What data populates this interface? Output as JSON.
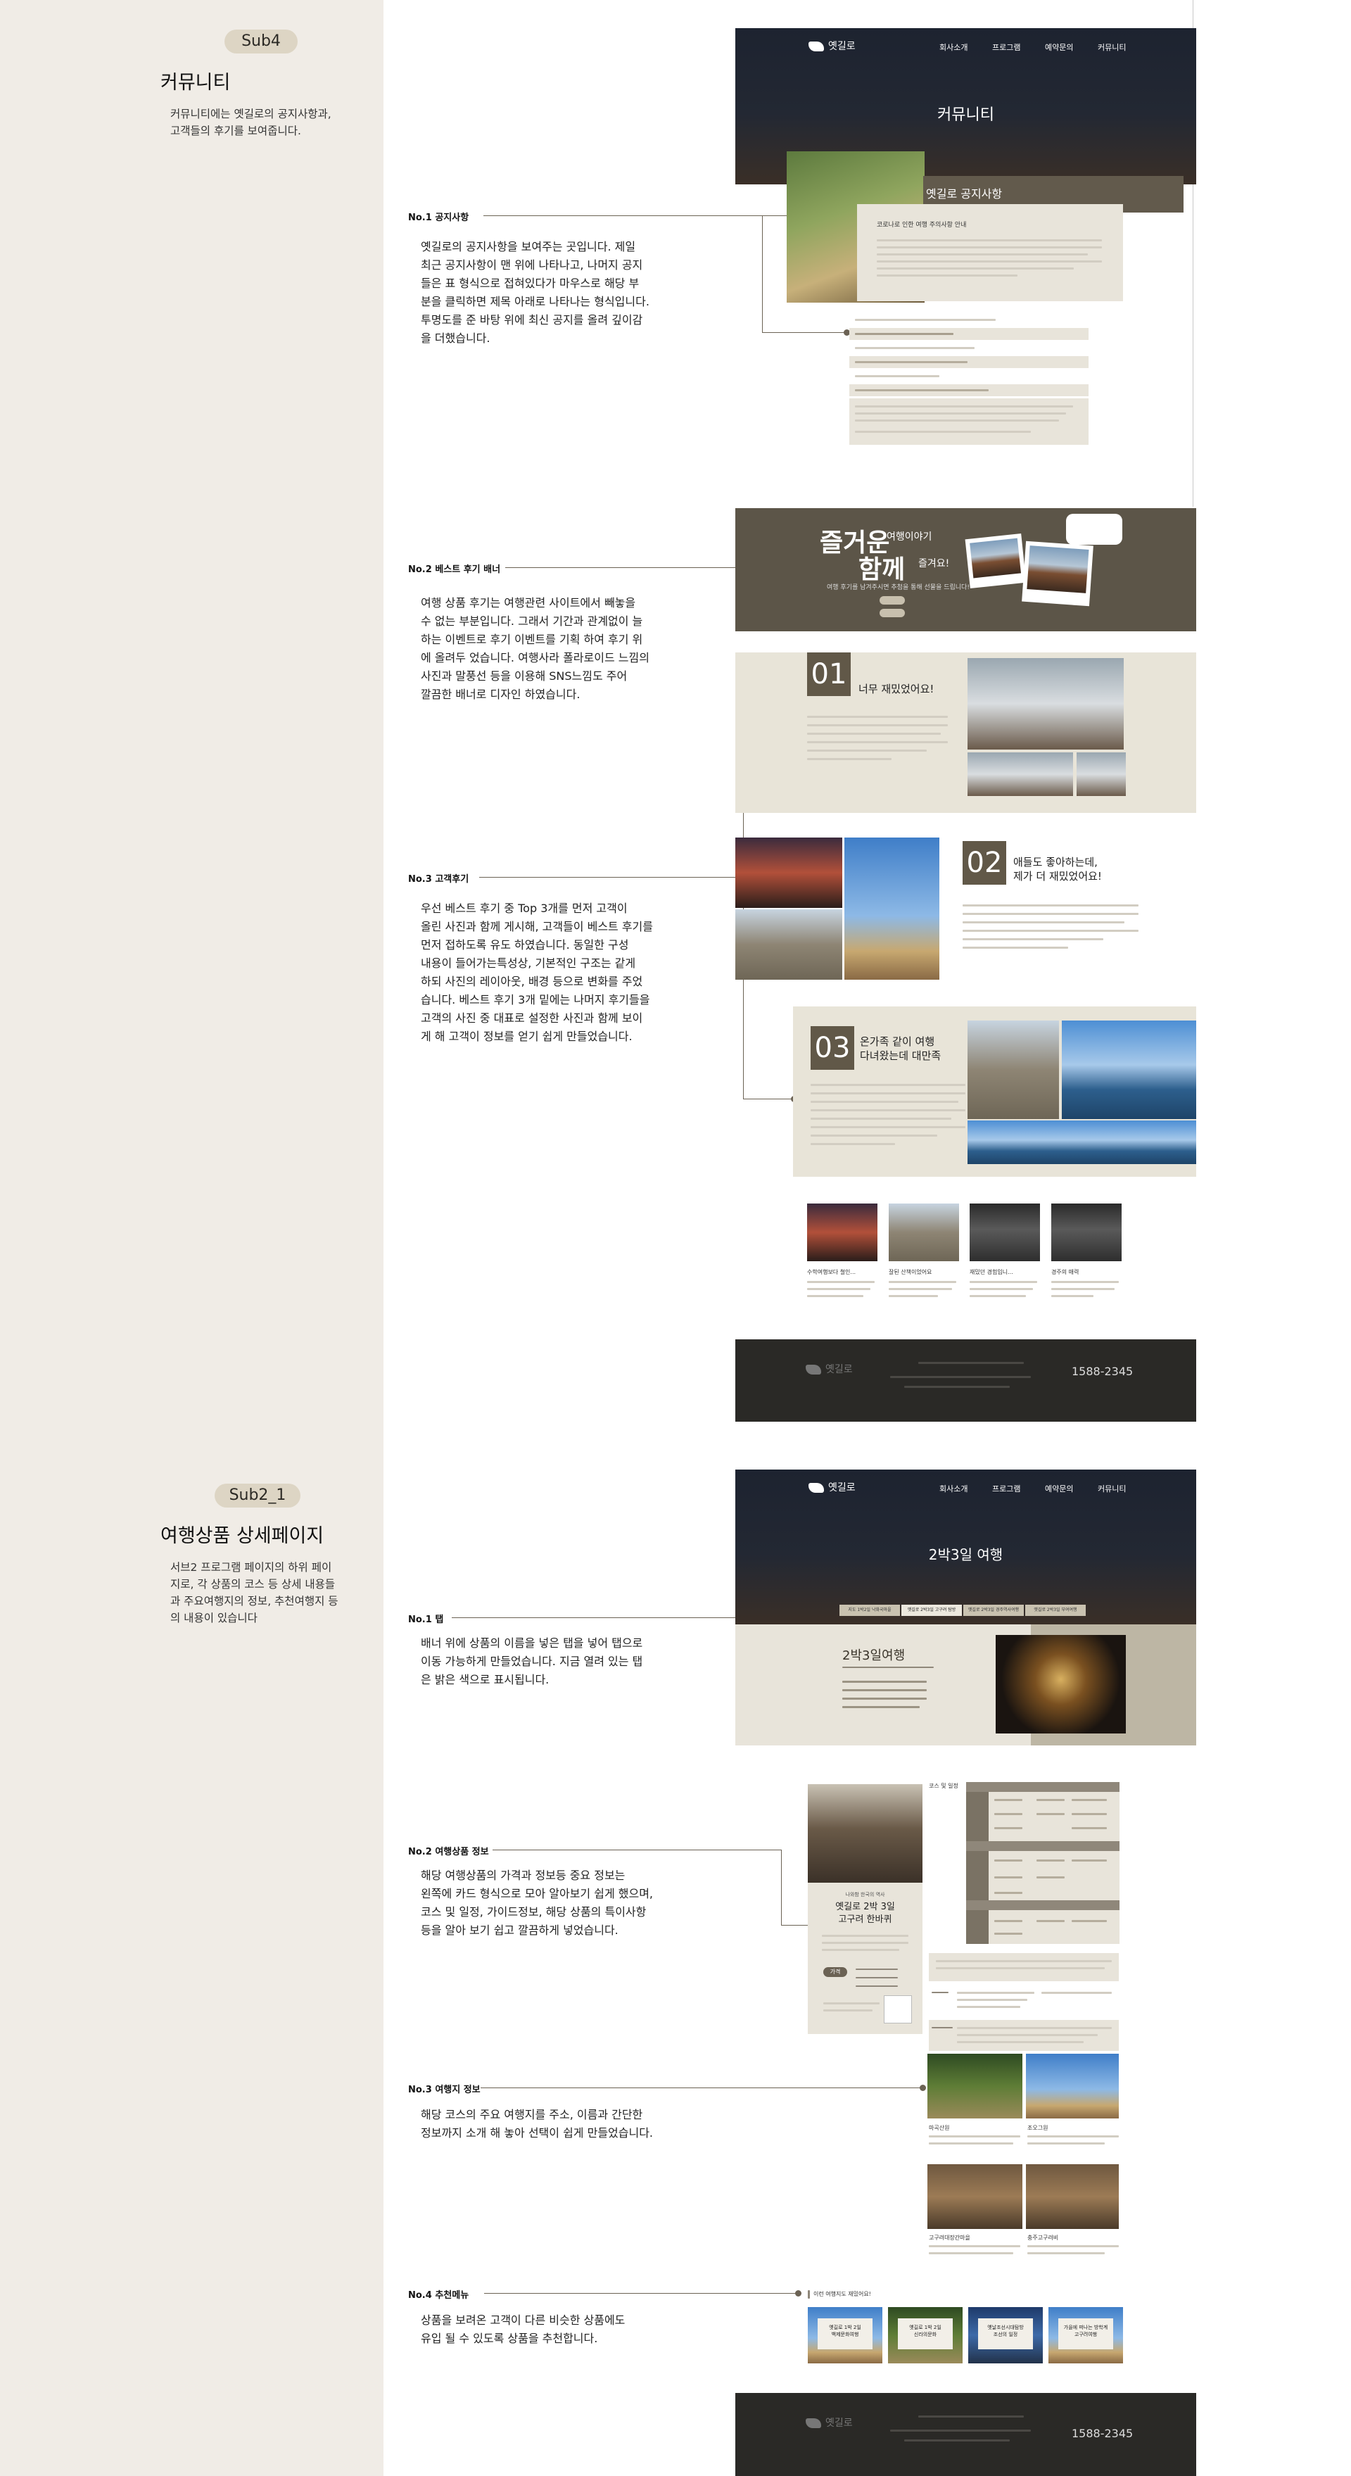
{
  "sections": {
    "sub4": {
      "badge": "Sub4",
      "title": "커뮤니티",
      "desc": "커뮤니티에는 옛길로의 공지사항과,\n고객들의 후기를 보여줍니다."
    },
    "sub2_1": {
      "badge": "Sub2_1",
      "title": "여행상품 상세페이지",
      "desc": "서브2 프로그램 페이지의 하위 페이\n지로, 각 상품의 코스 등 상세 내용들\n과 주요여행지의 정보, 추천여행지 등\n의 내용이 있습니다"
    }
  },
  "notes": {
    "n1": {
      "label": "No.1 공지사항",
      "text": "옛길로의 공지사항을 보여주는 곳입니다. 제일\n최근 공지사항이 맨 위에 나타나고, 나머지 공지\n들은 표 형식으로 접혀있다가 마우스로 해당 부\n분을 클릭하면 제목 아래로 나타나는 형식입니다.\n투명도를 준 바탕 위에 최신 공지를 올려 깊이감\n을 더했습니다."
    },
    "n2": {
      "label": "No.2 베스트 후기 배너",
      "text": "여행 상품 후기는 여행관련 사이트에서 빼놓을\n수 없는 부분입니다. 그래서 기간과 관계없이 늘\n하는 이벤트로 후기 이벤트를 기획 하여 후기 위\n에 올려두 었습니다. 여행사라 폴라로이드 느낌의\n사진과 말풍선 등을 이용해 SNS느낌도 주어\n깔끔한 배너로 디자인 하였습니다."
    },
    "n3": {
      "label": "No.3 고객후기",
      "text": "우선 베스트 후기 중 Top 3개를 먼저 고객이\n올린 사진과 함께 게시해, 고객들이 베스트 후기를\n먼저 접하도록 유도 하였습니다. 동일한 구성\n내용이 들어가는특성상, 기본적인 구조는 같게\n하되 사진의 레이아웃, 배경 등으로 변화를 주었\n습니다. 베스트 후기 3개 밑에는 나머지 후기들을\n고객의 사진 중 대표로 설정한 사진과 함께 보이\n게 해 고객이 정보를 얻기 쉽게 만들었습니다."
    },
    "n4": {
      "label": "No.1 탭",
      "text": "배너 위에 상품의 이름을 넣은 탭을 넣어 탭으로\n이동 가능하게 만들었습니다. 지금 열려 있는 탭\n은 밝은 색으로 표시됩니다."
    },
    "n5": {
      "label": "No.2 여행상품 정보",
      "text": "해당 여행상품의 가격과 정보등 중요 정보는\n왼쪽에 카드 형식으로 모아 알아보기 쉽게 했으며,\n코스 및 일정, 가이드정보, 해당 상품의 특이사항\n등을 알아 보기 쉽고 깔끔하게 넣었습니다."
    },
    "n6": {
      "label": "No.3 여행지 정보",
      "text": "해당 코스의 주요 여행지를 주소, 이름과 간단한\n정보까지 소개 해 놓아 선택이 쉽게 만들었습니다."
    },
    "n7": {
      "label": "No.4 추천메뉴",
      "text": "상품을 보려온 고객이 다른 비슷한 상품에도\n유입 될 수 있도록 상품을 추천합니다."
    }
  },
  "mock_community": {
    "logo": "옛길로",
    "nav": [
      "회사소개",
      "프로그램",
      "예약문의",
      "커뮤니티"
    ],
    "hero_title": "커뮤니티",
    "notice_title": "옛길로 공지사항",
    "notice_headline": "코로나로 인한 여행 주의사항 안내",
    "banner_big1": "즐거운",
    "banner_small1": "여행이야기",
    "banner_big2": "함께",
    "banner_small2": "즐겨요!",
    "banner_sub": "여행 후기를 남겨주시면 추첨을 통해 선물을 드립니다!",
    "review1": "너무 재밌었어요!",
    "review2": "애들도 좋아하는데,\n제가 더 재밌었어요!",
    "review3": "온가족 같이 여행\n다녀왔는데 대만족",
    "nums": [
      "01",
      "02",
      "03"
    ],
    "thumbs": [
      "수학여행보다 철인...",
      "잘된 산책이었어요",
      "재밌던 경험입니...",
      "경주의 매력"
    ],
    "footer_phone": "1588-2345"
  },
  "mock_detail": {
    "logo": "옛길로",
    "nav": [
      "회사소개",
      "프로그램",
      "예약문의",
      "커뮤니티"
    ],
    "hero_title": "2박3일 여행",
    "tabs": [
      "지도 1박2일 낙화국마을",
      "옛길로 2박3일 고구려 탐방",
      "옛길로 2박3일 경주역사여행",
      "옛길로 2박3일 부여여행"
    ],
    "section_title": "2박3일여행",
    "card_sub": "나와함 한국의 역사",
    "card_title": "옛길로 2박 3일\n고구려 한바퀴",
    "price_label": "가격",
    "course_label": "코스 및 일정",
    "places": [
      "마곡산원",
      "조오그원",
      "고구려대장간마을",
      "충주고구려비"
    ],
    "rec_title": "이런 여행지도 재밌어요!",
    "rec_cards": [
      "옛길로 1박 2일\n백제문화여행",
      "옛길로 1박 2일\n신라의문화",
      "옛날조선시대탐방\n조선의 일정",
      "가을에 떠나는 방학계\n고구려여행"
    ],
    "footer_phone": "1588-2345"
  }
}
